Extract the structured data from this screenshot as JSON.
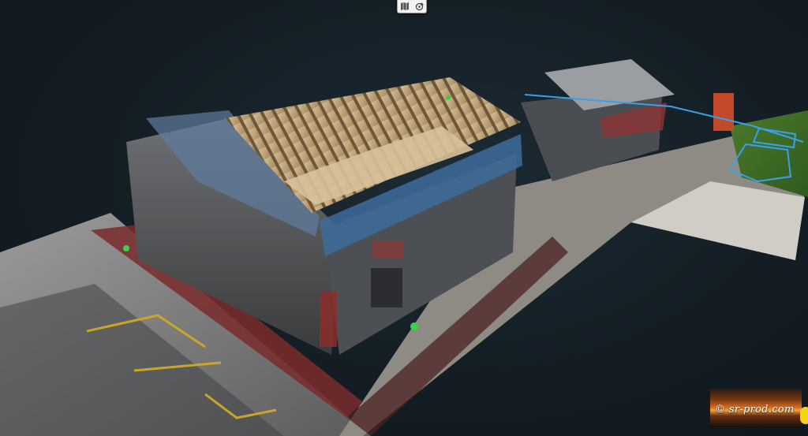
{
  "toolbar": {
    "buttons": [
      {
        "icon": "map-icon"
      },
      {
        "icon": "rotate-view-icon"
      }
    ]
  },
  "watermark": {
    "text": "© sr-prod.com"
  },
  "edge_badge": {
    "text": ""
  },
  "colors": {
    "selection_outline": "#3aa0e8",
    "background": "#141d24",
    "roof": "#c8b089"
  }
}
